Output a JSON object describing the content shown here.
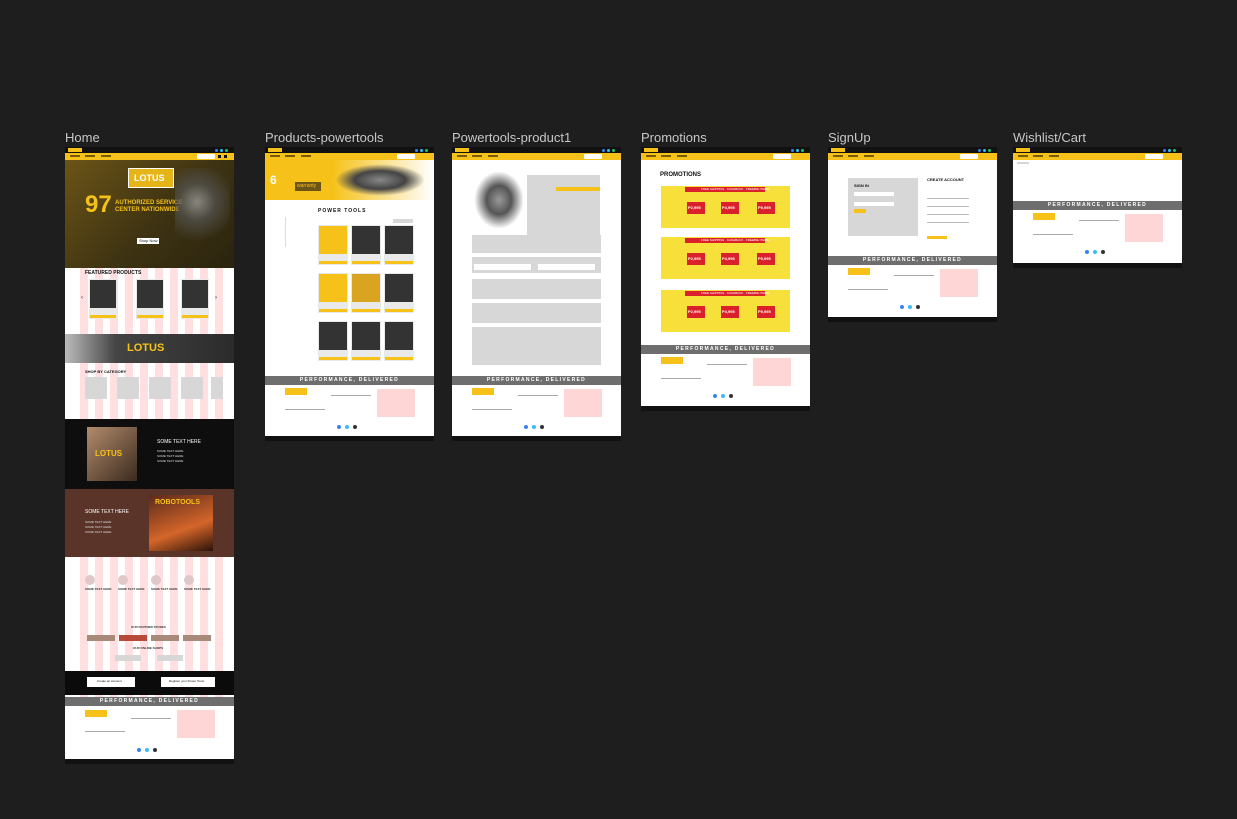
{
  "canvas": {
    "background": "#1e1e1e"
  },
  "colors": {
    "brand_yellow": "#f6c21a",
    "footer_gray": "#6e6e6e",
    "promo_red": "#d9202b"
  },
  "frames": {
    "home": {
      "label": "Home"
    },
    "products": {
      "label": "Products-powertools",
      "heading": "POWER TOOLS",
      "banner_number": "6",
      "banner_word": "warranty"
    },
    "product1": {
      "label": "Powertools-product1"
    },
    "promotions": {
      "label": "Promotions",
      "heading": "PROMOTIONS",
      "banner_strip": "FREE SHIPPING · CASHBACK · FREEBIE ITEMS",
      "prices": [
        "P2,995",
        "P4,995",
        "P5,995"
      ]
    },
    "signup": {
      "label": "SignUp",
      "signin_title": "SIGN IN",
      "create_title": "CREATE ACCOUNT"
    },
    "wishlist": {
      "label": "Wishlist/Cart"
    }
  },
  "home": {
    "hero_number": "97",
    "hero_line1": "AUTHORIZED SERVICE",
    "hero_line2": "CENTER NATIONWIDE",
    "hero_logo": "LOTUS",
    "shop_now": "Shop Now",
    "featured_title": "FEATURED PRODUCTS",
    "band_logo": "LOTUS",
    "shop_by_category": "SHOP BY CATEGORY",
    "some_text_title": "SOME TEXT HERE",
    "some_text_line": "SOME TEXT HERE",
    "partner_stores": "OUR PARTNER STORES",
    "online_shops": "OUR ONLINE SHOPS",
    "create_account_btn": "Create an Account",
    "register_btn": "Register your Power Tools",
    "roboteels_logo": "ROBOTOOLS"
  },
  "footer": {
    "tagline": "PERFORMANCE, DELIVERED",
    "logo": "LOTUS"
  }
}
